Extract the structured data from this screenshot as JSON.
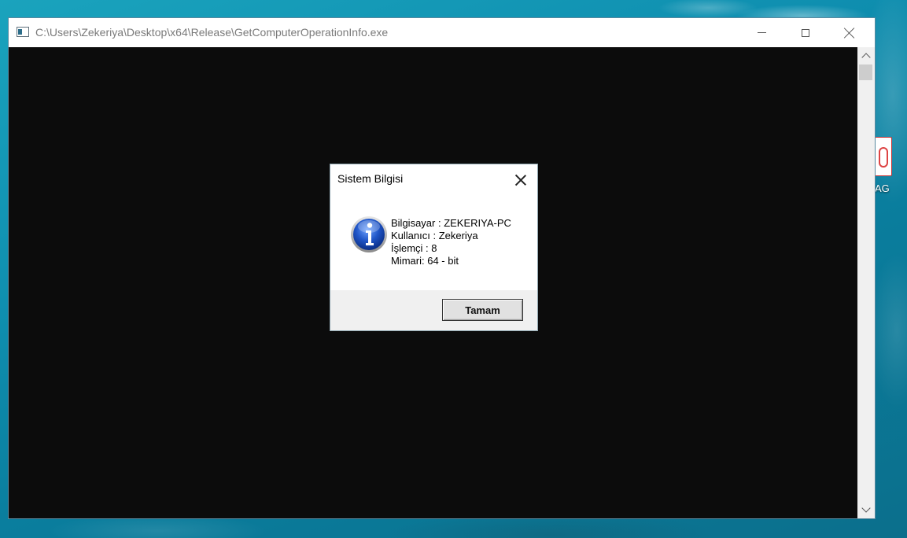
{
  "desktop": {
    "icon_label": "AG"
  },
  "window": {
    "title": "C:\\Users\\Zekeriya\\Desktop\\x64\\Release\\GetComputerOperationInfo.exe",
    "icon": "console-app-icon",
    "controls": {
      "minimize": "minimize-icon",
      "maximize": "maximize-icon",
      "close": "close-icon"
    }
  },
  "dialog": {
    "title": "Sistem Bilgisi",
    "icon": "info-icon",
    "lines": [
      "Bilgisayar : ZEKERIYA-PC",
      "Kullanıcı : Zekeriya",
      "İşlemçi : 8",
      "Mimari: 64 - bit"
    ],
    "ok_label": "Tamam"
  },
  "colors": {
    "console_bg": "#0c0c0c",
    "info_blue": "#1f55c7",
    "desktop_teal": "#0f8fb0"
  }
}
